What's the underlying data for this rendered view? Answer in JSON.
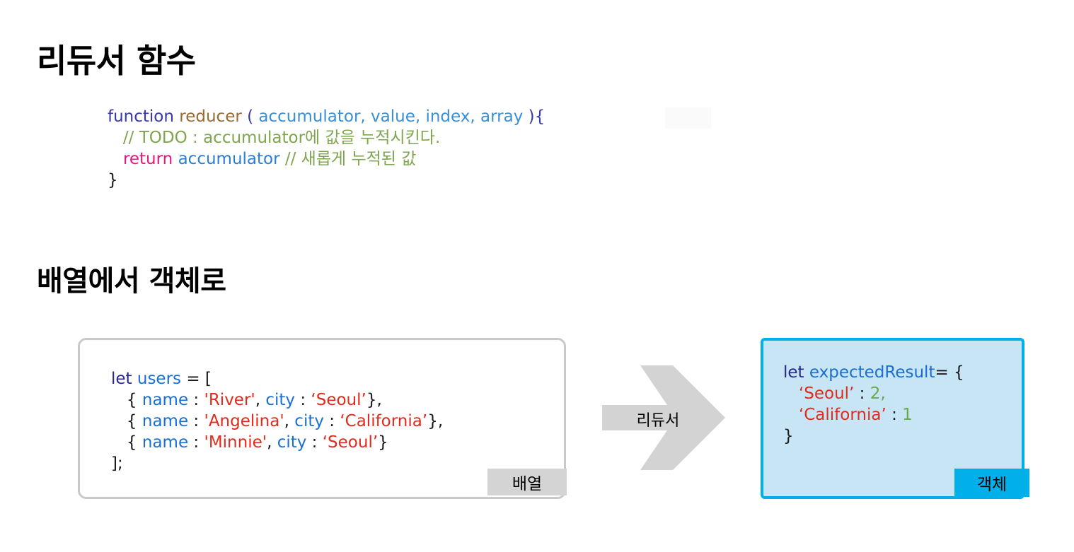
{
  "page": {
    "background": "#ffffff",
    "language": "ko"
  },
  "sections": {
    "reducer_function": {
      "heading": "리듀서 함수",
      "code_lines": [
        [
          {
            "t": "function",
            "c": "keyword"
          },
          {
            "t": " ",
            "c": "punct"
          },
          {
            "t": "reducer",
            "c": "fnname"
          },
          {
            "t": " (",
            "c": "punct-blue"
          },
          {
            "t": " accumulator, value, index, array ",
            "c": "param"
          },
          {
            "t": "){",
            "c": "punct-blue"
          }
        ],
        [
          {
            "t": "   // TODO : accumulator에 값을 누적시킨다.",
            "c": "comment"
          }
        ],
        [
          {
            "t": "   ",
            "c": "punct"
          },
          {
            "t": "return",
            "c": "return"
          },
          {
            "t": " ",
            "c": "punct"
          },
          {
            "t": "accumulator",
            "c": "ident"
          },
          {
            "t": " ",
            "c": "punct"
          },
          {
            "t": "// 새롭게 누적된 값",
            "c": "comment"
          }
        ],
        [
          {
            "t": "}",
            "c": "punct"
          }
        ]
      ]
    },
    "array_to_object": {
      "heading": "배열에서 객체로",
      "array_box": {
        "badge_label": "배열",
        "border_color": "#c9c9c9",
        "fill_color": "#ffffff",
        "badge_color": "#d4d4d4",
        "code_lines": [
          [
            {
              "t": "let",
              "c": "let"
            },
            {
              "t": " ",
              "c": "punct"
            },
            {
              "t": "users",
              "c": "var"
            },
            {
              "t": " = [",
              "c": "punct"
            }
          ],
          [
            {
              "t": "   { ",
              "c": "punct"
            },
            {
              "t": "name",
              "c": "prop"
            },
            {
              "t": " : ",
              "c": "punct"
            },
            {
              "t": "'River'",
              "c": "string"
            },
            {
              "t": ", ",
              "c": "punct"
            },
            {
              "t": "city",
              "c": "prop"
            },
            {
              "t": " : ",
              "c": "punct"
            },
            {
              "t": "‘Seoul’",
              "c": "string"
            },
            {
              "t": "},",
              "c": "punct"
            }
          ],
          [
            {
              "t": "   { ",
              "c": "punct"
            },
            {
              "t": "name",
              "c": "prop"
            },
            {
              "t": " : ",
              "c": "punct"
            },
            {
              "t": "'Angelina'",
              "c": "string"
            },
            {
              "t": ", ",
              "c": "punct"
            },
            {
              "t": "city",
              "c": "prop"
            },
            {
              "t": " : ",
              "c": "punct"
            },
            {
              "t": "‘California’",
              "c": "string"
            },
            {
              "t": "},",
              "c": "punct"
            }
          ],
          [
            {
              "t": "   { ",
              "c": "punct"
            },
            {
              "t": "name",
              "c": "prop"
            },
            {
              "t": " : ",
              "c": "punct"
            },
            {
              "t": "'Minnie'",
              "c": "string"
            },
            {
              "t": ", ",
              "c": "punct"
            },
            {
              "t": "city",
              "c": "prop"
            },
            {
              "t": " : ",
              "c": "punct"
            },
            {
              "t": "‘Seoul’",
              "c": "string"
            },
            {
              "t": "}",
              "c": "punct"
            }
          ],
          [
            {
              "t": "];",
              "c": "punct"
            }
          ]
        ]
      },
      "arrow": {
        "label": "리듀서",
        "color": "#d3d3d3"
      },
      "object_box": {
        "badge_label": "객체",
        "border_color": "#02b0e9",
        "fill_color": "#c7e5f4",
        "badge_color": "#02b0e9",
        "code_lines": [
          [
            {
              "t": "let",
              "c": "let"
            },
            {
              "t": " ",
              "c": "punct"
            },
            {
              "t": "expectedResult",
              "c": "var"
            },
            {
              "t": "= {",
              "c": "punct"
            }
          ],
          [
            {
              "t": "   ",
              "c": "punct"
            },
            {
              "t": "‘Seoul’",
              "c": "string"
            },
            {
              "t": " : ",
              "c": "punct"
            },
            {
              "t": "2,",
              "c": "number"
            }
          ],
          [
            {
              "t": "   ",
              "c": "punct"
            },
            {
              "t": "‘California’",
              "c": "string"
            },
            {
              "t": " : ",
              "c": "punct"
            },
            {
              "t": "1",
              "c": "number"
            }
          ],
          [
            {
              "t": "}",
              "c": "punct"
            }
          ]
        ]
      }
    }
  },
  "colors": {
    "keyword": "#3838a8",
    "function_name": "#9a6a33",
    "parameter": "#3a8fd4",
    "comment": "#7fa54f",
    "return_keyword": "#e5187c",
    "identifier": "#2a7fd4",
    "let_keyword": "#27278c",
    "variable": "#1a6fd4",
    "property": "#1a6fd4",
    "string": "#e12b1c",
    "number": "#6aa84f",
    "punctuation": "#1b1b1b",
    "accent_cyan": "#02b0e9",
    "object_fill": "#c7e5f4",
    "arrow_gray": "#d3d3d3",
    "badge_gray": "#d4d4d4"
  }
}
